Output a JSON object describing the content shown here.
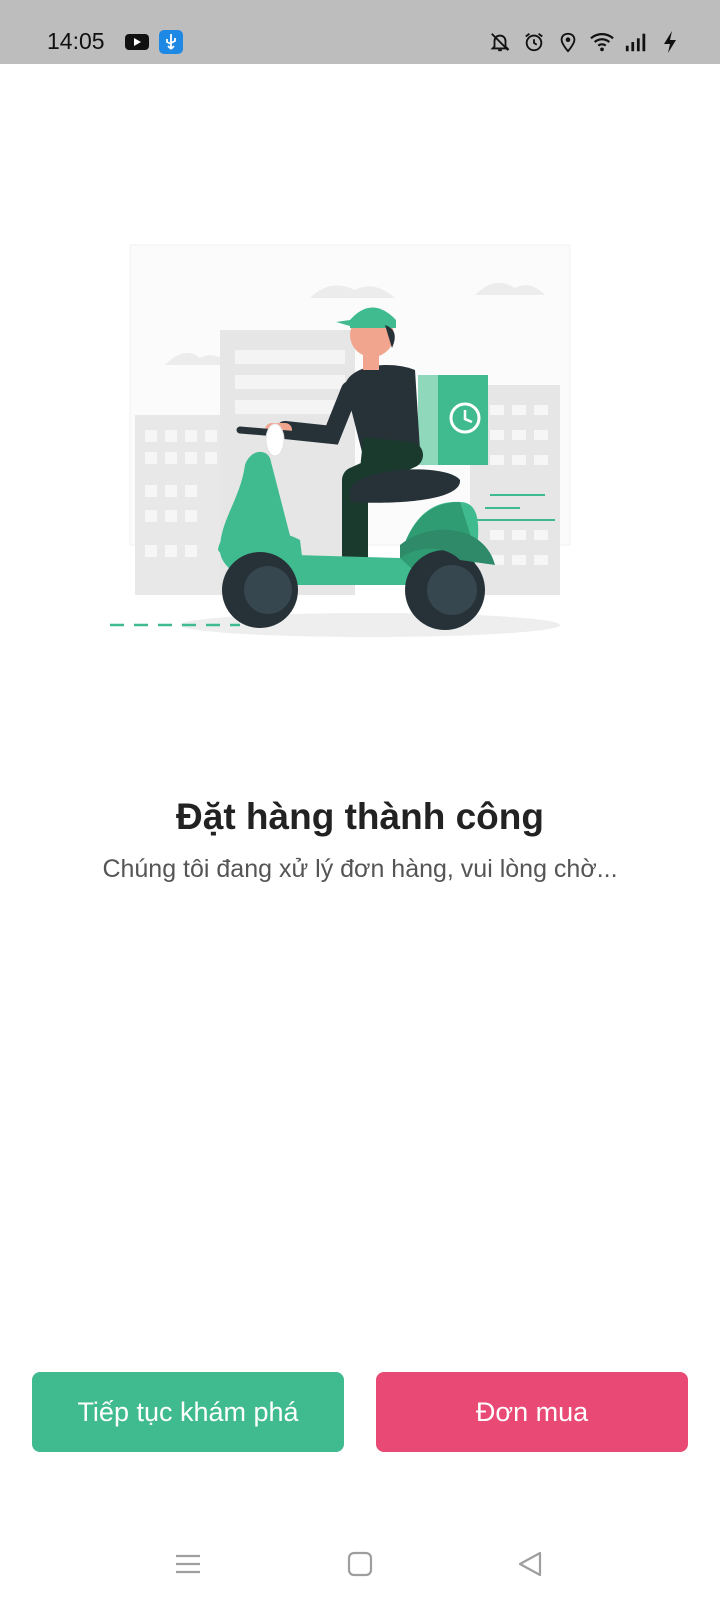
{
  "status_bar": {
    "time": "14:05",
    "left_icons": [
      "youtube-icon",
      "usb-icon"
    ],
    "right_icons": [
      "bell-off-icon",
      "alarm-icon",
      "location-icon",
      "wifi-icon",
      "signal-icon",
      "charging-icon"
    ]
  },
  "illustration": {
    "name": "delivery-scooter-illustration",
    "accent_color": "#40bb8f"
  },
  "message": {
    "title": "Đặt hàng thành công",
    "subtitle": "Chúng tôi đang xử lý đơn hàng, vui lòng chờ..."
  },
  "buttons": {
    "continue_label": "Tiếp tục khám phá",
    "continue_color": "#40bb8f",
    "orders_label": "Đơn mua",
    "orders_color": "#e84a75"
  },
  "nav_bar": {
    "items": [
      "menu-icon",
      "home-icon",
      "back-icon"
    ]
  }
}
